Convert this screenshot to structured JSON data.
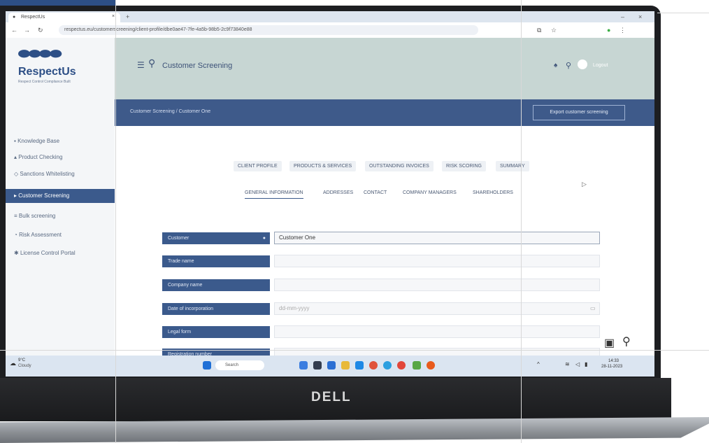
{
  "browser": {
    "tab_title": "RespectUs",
    "url": "respectus.eu/customerscreening/client-profile/dbe0ae47-7fe-4a5b-98b5-2c9f73840e88",
    "window_controls": [
      "–",
      "×"
    ]
  },
  "brand": {
    "name": "RespectUs",
    "tagline": "Respect Control Compliance Built"
  },
  "sidebar": {
    "items": [
      {
        "label": "Knowledge Base",
        "icon": "book-icon"
      },
      {
        "label": "Product Checking",
        "icon": "box-icon"
      },
      {
        "label": "Sanctions Whitelisting",
        "icon": "shield-icon"
      },
      {
        "label": "Customer Screening",
        "icon": "user-icon",
        "active": true
      },
      {
        "label": "Bulk screening",
        "icon": "list-icon"
      },
      {
        "label": "Risk Assessment",
        "icon": "gauge-icon"
      },
      {
        "label": "License Control Portal",
        "icon": "key-icon"
      }
    ]
  },
  "header": {
    "menu_icon": "☰",
    "title": "Customer Screening",
    "user": "Logout"
  },
  "banner": {
    "breadcrumb": "Customer Screening / Customer One",
    "button_label": "Export customer screening"
  },
  "tabs_primary": [
    "CLIENT PROFILE",
    "PRODUCTS & SERVICES",
    "OUTSTANDING INVOICES",
    "RISK SCORING",
    "SUMMARY"
  ],
  "tabs_secondary": [
    "GENERAL INFORMATION",
    "ADDRESSES",
    "CONTACT",
    "COMPANY MANAGERS",
    "SHAREHOLDERS"
  ],
  "form": {
    "fields": [
      {
        "label": "Customer",
        "value": "Customer One",
        "required": true
      },
      {
        "label": "Trade name",
        "value": ""
      },
      {
        "label": "Company name",
        "value": ""
      },
      {
        "label": "Date of incorporation",
        "value": "",
        "placeholder": "dd-mm-yyyy"
      },
      {
        "label": "Legal form",
        "value": ""
      },
      {
        "label": "Registration number",
        "value": ""
      }
    ]
  },
  "taskbar": {
    "weather": "9°C",
    "weather_sub": "Cloudy",
    "search": "Search",
    "time": "14:33",
    "date": "28-11-2023"
  },
  "laptop": {
    "brand": "DELL"
  },
  "colors": {
    "primary": "#3b5a8c",
    "header_bg": "#c7d6d3",
    "banner_bg": "#3e5a8a"
  }
}
